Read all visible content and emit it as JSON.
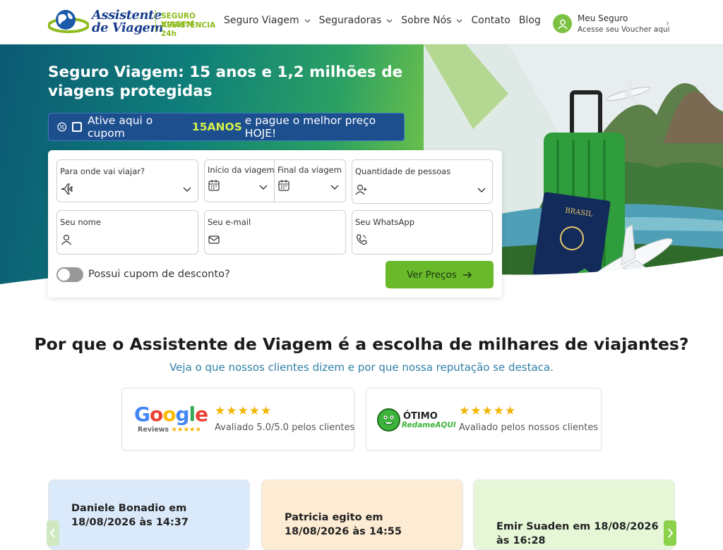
{
  "logo": {
    "line1": "Assistente",
    "line2": "de Viagem",
    "tag1": "SEGURO VIAGEM",
    "tag2": "ASSISTÊNCIA 24h"
  },
  "nav": {
    "items": [
      {
        "label": "Seguro Viagem",
        "dropdown": true
      },
      {
        "label": "Seguradoras",
        "dropdown": true
      },
      {
        "label": "Sobre Nós",
        "dropdown": true
      },
      {
        "label": "Contato",
        "dropdown": false
      },
      {
        "label": "Blog",
        "dropdown": false
      }
    ]
  },
  "account": {
    "title": "Meu Seguro",
    "subtitle": "Acesse seu Voucher aqui"
  },
  "hero": {
    "title": "Seguro Viagem: 15 anos e 1,2 milhões de viagens protegidas",
    "coupon": {
      "before": "Ative aqui o cupom",
      "code": "15ANOS",
      "after": "e pague o melhor preço HOJE!"
    }
  },
  "form": {
    "destination_label": "Para onde vai viajar?",
    "start_label": "Início da viagem",
    "end_label": "Final da viagem",
    "people_label": "Quantidade de pessoas",
    "name_label": "Seu nome",
    "email_label": "Seu e-mail",
    "whatsapp_label": "Seu WhatsApp",
    "coupon_toggle_label": "Possui cupom de desconto?",
    "submit_label": "Ver Preços"
  },
  "why": {
    "title": "Por que o Assistente de Viagem é a escolha de milhares de viajantes?",
    "subtitle": "Veja o que nossos clientes dizem e por que nossa reputação se destaca."
  },
  "ratings": [
    {
      "brand": "Google",
      "brand_sub": "Reviews",
      "stars": 5,
      "text": "Avaliado 5.0/5.0 pelos clientes"
    },
    {
      "brand": "ÓTIMO",
      "brand_sub": "RedameAQUI",
      "stars": 5,
      "text": "Avaliado pelos nossos clientes"
    }
  ],
  "testimonials": [
    {
      "author_line": "Daniele Bonadio em 18/08/2026 às 14:37",
      "bg": "#dbeafb"
    },
    {
      "author_line": "Patricia egito em 18/08/2026 às 14:55",
      "bg": "#fdebd3"
    },
    {
      "author_line": "Emir Suaden em 18/08/2026 às 16:28",
      "bg": "#e6f7d8"
    }
  ],
  "colors": {
    "brand_blue": "#1a3e8c",
    "brand_green": "#6ab92a",
    "coupon_bg": "#1d4f8f",
    "coupon_code": "#d6f24a",
    "link_blue": "#2f7fa6",
    "star": "#f4b400"
  }
}
